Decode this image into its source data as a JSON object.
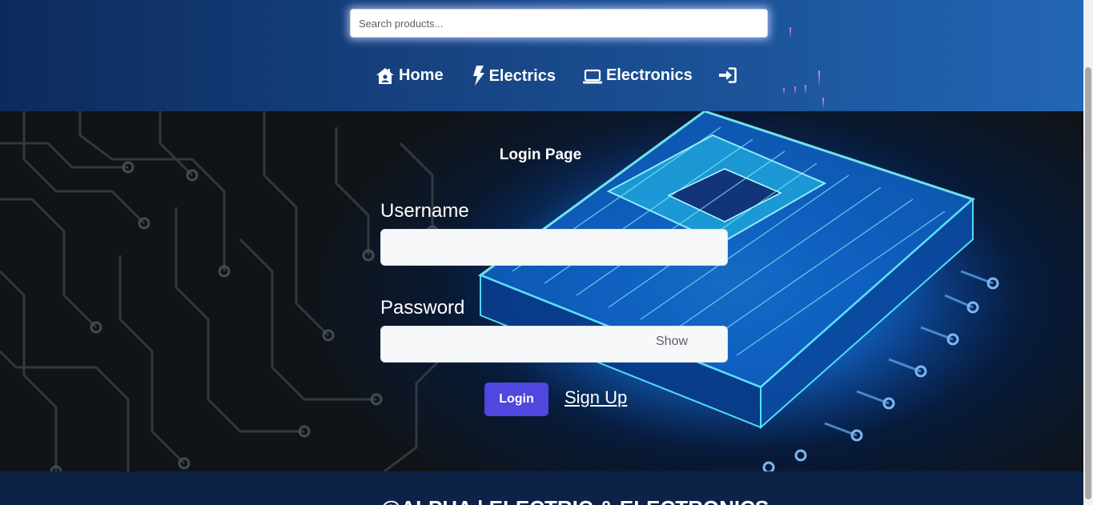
{
  "search": {
    "placeholder": "Search products..."
  },
  "nav": {
    "items": [
      {
        "label": "Home",
        "icon": "home-icon"
      },
      {
        "label": "Electrics",
        "icon": "lightning-icon"
      },
      {
        "label": "Electronics",
        "icon": "laptop-icon"
      },
      {
        "label": "",
        "icon": "sign-in-icon"
      }
    ]
  },
  "login": {
    "title": "Login Page",
    "username_label": "Username",
    "username_value": "",
    "password_label": "Password",
    "password_value": "",
    "show_label": "Show",
    "login_button": "Login",
    "signup_link": "Sign Up"
  },
  "footer": {
    "text": "@ALPHA | ELECTRIC & ELECTRONICS"
  },
  "colors": {
    "header_bg": "#1b5196",
    "login_button_bg": "#5046e0",
    "footer_bg": "#0c2347"
  }
}
